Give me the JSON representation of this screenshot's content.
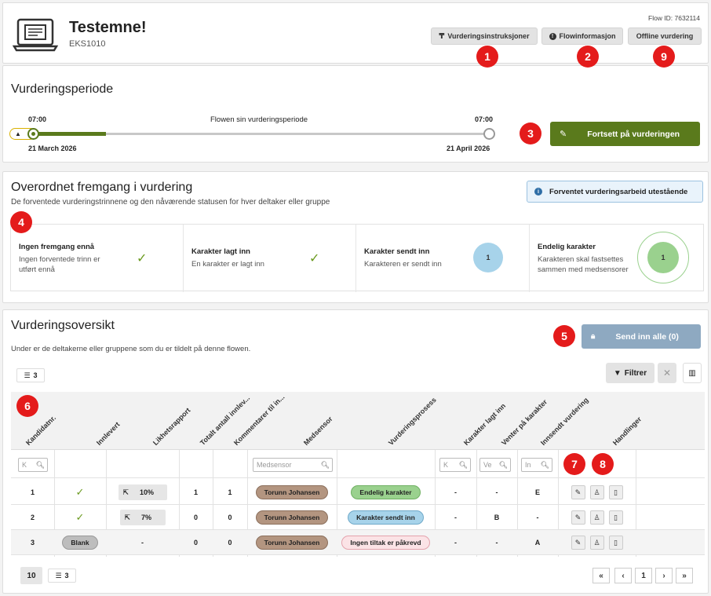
{
  "header": {
    "title": "Testemne!",
    "code": "EKS1010",
    "flow_id": "Flow ID: 7632114",
    "btn_instructions": "Vurderingsinstruksjoner",
    "btn_flowinfo": "Flowinformasjon",
    "btn_offline": "Offline vurdering"
  },
  "badges": {
    "b1": "1",
    "b2": "2",
    "b9": "9",
    "b3": "3",
    "b4": "4",
    "b5": "5",
    "b6": "6",
    "b7": "7",
    "b8": "8"
  },
  "period": {
    "title": "Vurderingsperiode",
    "start_time": "07:00",
    "end_time": "07:00",
    "caption": "Flowen sin vurderingsperiode",
    "start_date": "21 March 2026",
    "end_date": "21 April 2026",
    "progress": 0.16,
    "continue_btn": "Fortsett på vurderingen"
  },
  "progress": {
    "title": "Overordnet fremgang i vurdering",
    "subtitle": "De forventede vurderingstrinnene og den nåværende statusen for hver deltaker eller gruppe",
    "info_badge": "Forventet vurderingsarbeid utestående",
    "steps": [
      {
        "title": "Ingen fremgang ennå",
        "desc1": "Ingen forventede trinn er",
        "desc2": "utført ennå"
      },
      {
        "title": "Karakter lagt inn",
        "desc1": "En karakter er lagt inn",
        "desc2": ""
      },
      {
        "title": "Karakter sendt inn",
        "desc1": "Karakteren er sendt inn",
        "desc2": "",
        "count": "1"
      },
      {
        "title": "Endelig karakter",
        "desc1": "Karakteren skal fastsettes",
        "desc2": "sammen med medsensorer",
        "count": "1"
      }
    ]
  },
  "overview": {
    "title": "Vurderingsoversikt",
    "subtitle": "Under er de deltakerne eller gruppene som du er tildelt på denne flowen.",
    "submit_all": "Send inn alle (0)",
    "list_count": "3",
    "filter_btn": "Filtrer",
    "columns": [
      "Kandidatnr.",
      "Innlevert",
      "Likhetsrapport",
      "Totalt antall innlev...",
      "Kommentarer til in...",
      "Medsensor",
      "Vurderingsprosess",
      "Karakter lagt inn",
      "Venter på karakter",
      "Innsendt vurdering",
      "Handlinger"
    ],
    "filter_placeholders": {
      "kandidat": "K",
      "medsensor": "Medsensor",
      "karakter": "K",
      "venter": "Ve",
      "innsendt": "In"
    },
    "rows": [
      {
        "cand": "1",
        "delivered": "✓",
        "similarity": "10%",
        "total": "1",
        "comments": "1",
        "censor": "Torunn Johansen",
        "process": "Endelig karakter",
        "grade_in": "-",
        "waiting": "-",
        "submitted": "E"
      },
      {
        "cand": "2",
        "delivered": "✓",
        "similarity": "7%",
        "total": "0",
        "comments": "0",
        "censor": "Torunn Johansen",
        "process": "Karakter sendt inn",
        "grade_in": "-",
        "waiting": "B",
        "submitted": "-"
      },
      {
        "cand": "3",
        "delivered": "Blank",
        "similarity": "-",
        "total": "0",
        "comments": "0",
        "censor": "Torunn Johansen",
        "process": "Ingen tiltak er påkrevd",
        "grade_in": "-",
        "waiting": "-",
        "submitted": "A"
      }
    ],
    "page_size": "10",
    "footer_count": "3",
    "current_page": "1"
  },
  "colors": {
    "green": "#5a7a1c",
    "check": "#6a9a1f",
    "badge": "#e41b1b",
    "censor_chip": "#b39580",
    "final_chip": "#9ad18e",
    "sent_chip": "#a7d3ea",
    "none_chip": "#fbe3e6",
    "submit_btn": "#8ea9c1"
  }
}
